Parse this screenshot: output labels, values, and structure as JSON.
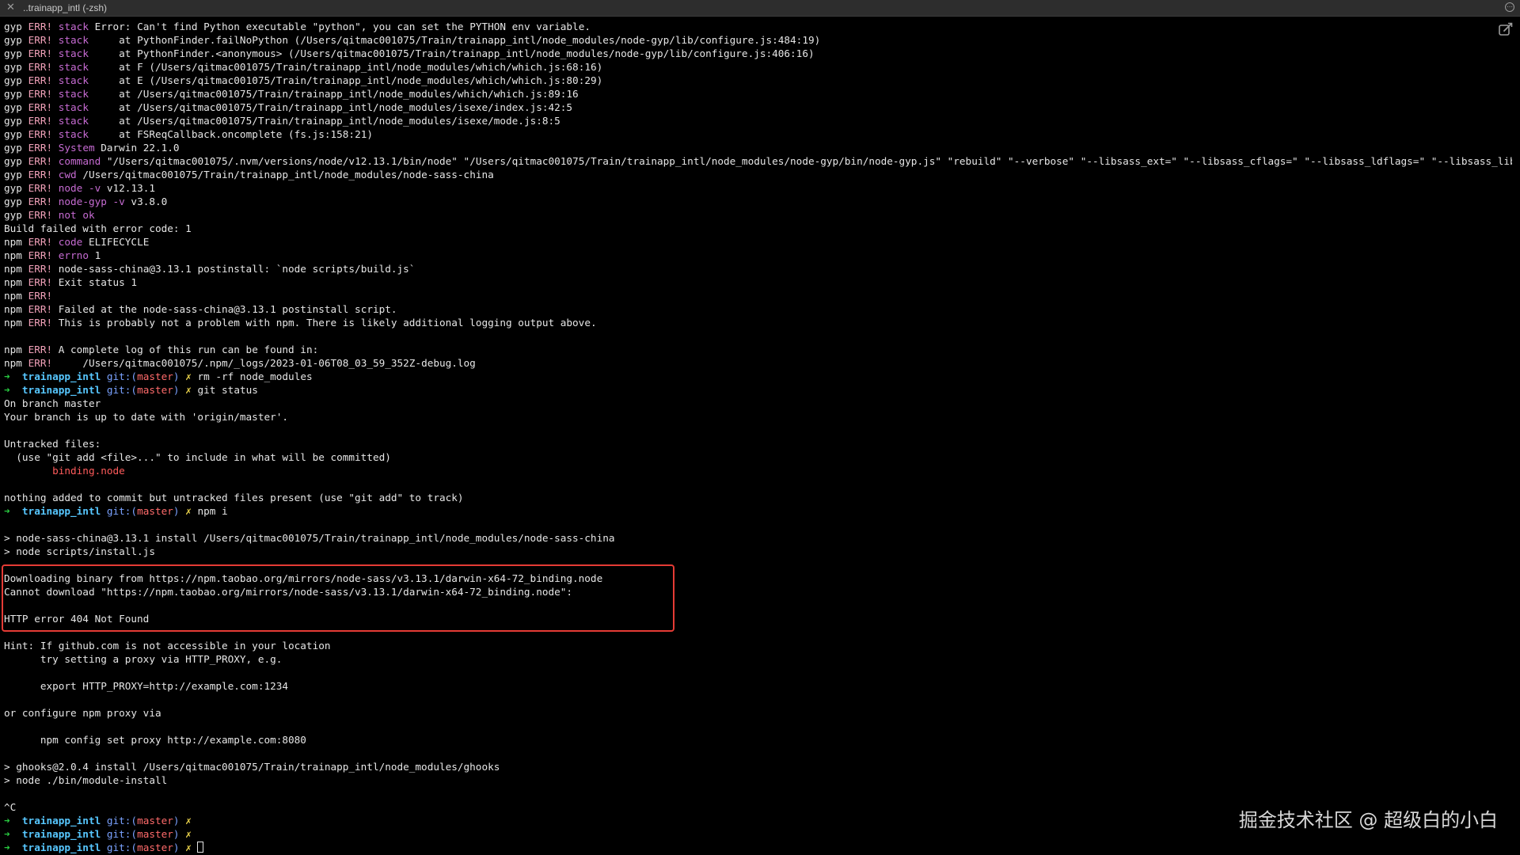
{
  "window": {
    "title": "..trainapp_intl (-zsh)"
  },
  "watermark": {
    "text": "掘金技术社区 @ 超级白的小白"
  },
  "colors": {
    "background": "#000000",
    "text": "#e6e6e6",
    "err": "#f0a0b8",
    "keyword": "#c66bd2",
    "prompt_arrow": "#28c940",
    "prompt_dir": "#57c7ff",
    "branch": "#ff6b6b",
    "highlight_box": "#e53b35"
  },
  "icons": {
    "close": "close-icon",
    "title_right": "window-options-icon",
    "edit": "edit-window-icon"
  },
  "terminal": {
    "lines": [
      [
        {
          "t": "gyp ",
          "c": "text"
        },
        {
          "t": "ERR!",
          "c": "err"
        },
        {
          "t": " ",
          "c": "text"
        },
        {
          "t": "stack",
          "c": "key"
        },
        {
          "t": " Error: Can't find Python executable \"python\", you can set the PYTHON env variable.",
          "c": "text"
        }
      ],
      [
        {
          "t": "gyp ",
          "c": "text"
        },
        {
          "t": "ERR!",
          "c": "err"
        },
        {
          "t": " ",
          "c": "text"
        },
        {
          "t": "stack",
          "c": "key"
        },
        {
          "t": "     at PythonFinder.failNoPython (/Users/qitmac001075/Train/trainapp_intl/node_modules/node-gyp/lib/configure.js:484:19)",
          "c": "text"
        }
      ],
      [
        {
          "t": "gyp ",
          "c": "text"
        },
        {
          "t": "ERR!",
          "c": "err"
        },
        {
          "t": " ",
          "c": "text"
        },
        {
          "t": "stack",
          "c": "key"
        },
        {
          "t": "     at PythonFinder.<anonymous> (/Users/qitmac001075/Train/trainapp_intl/node_modules/node-gyp/lib/configure.js:406:16)",
          "c": "text"
        }
      ],
      [
        {
          "t": "gyp ",
          "c": "text"
        },
        {
          "t": "ERR!",
          "c": "err"
        },
        {
          "t": " ",
          "c": "text"
        },
        {
          "t": "stack",
          "c": "key"
        },
        {
          "t": "     at F (/Users/qitmac001075/Train/trainapp_intl/node_modules/which/which.js:68:16)",
          "c": "text"
        }
      ],
      [
        {
          "t": "gyp ",
          "c": "text"
        },
        {
          "t": "ERR!",
          "c": "err"
        },
        {
          "t": " ",
          "c": "text"
        },
        {
          "t": "stack",
          "c": "key"
        },
        {
          "t": "     at E (/Users/qitmac001075/Train/trainapp_intl/node_modules/which/which.js:80:29)",
          "c": "text"
        }
      ],
      [
        {
          "t": "gyp ",
          "c": "text"
        },
        {
          "t": "ERR!",
          "c": "err"
        },
        {
          "t": " ",
          "c": "text"
        },
        {
          "t": "stack",
          "c": "key"
        },
        {
          "t": "     at /Users/qitmac001075/Train/trainapp_intl/node_modules/which/which.js:89:16",
          "c": "text"
        }
      ],
      [
        {
          "t": "gyp ",
          "c": "text"
        },
        {
          "t": "ERR!",
          "c": "err"
        },
        {
          "t": " ",
          "c": "text"
        },
        {
          "t": "stack",
          "c": "key"
        },
        {
          "t": "     at /Users/qitmac001075/Train/trainapp_intl/node_modules/isexe/index.js:42:5",
          "c": "text"
        }
      ],
      [
        {
          "t": "gyp ",
          "c": "text"
        },
        {
          "t": "ERR!",
          "c": "err"
        },
        {
          "t": " ",
          "c": "text"
        },
        {
          "t": "stack",
          "c": "key"
        },
        {
          "t": "     at /Users/qitmac001075/Train/trainapp_intl/node_modules/isexe/mode.js:8:5",
          "c": "text"
        }
      ],
      [
        {
          "t": "gyp ",
          "c": "text"
        },
        {
          "t": "ERR!",
          "c": "err"
        },
        {
          "t": " ",
          "c": "text"
        },
        {
          "t": "stack",
          "c": "key"
        },
        {
          "t": "     at FSReqCallback.oncomplete (fs.js:158:21)",
          "c": "text"
        }
      ],
      [
        {
          "t": "gyp ",
          "c": "text"
        },
        {
          "t": "ERR!",
          "c": "err"
        },
        {
          "t": " ",
          "c": "text"
        },
        {
          "t": "System",
          "c": "key"
        },
        {
          "t": " Darwin 22.1.0",
          "c": "text"
        }
      ],
      [
        {
          "t": "gyp ",
          "c": "text"
        },
        {
          "t": "ERR!",
          "c": "err"
        },
        {
          "t": " ",
          "c": "text"
        },
        {
          "t": "command",
          "c": "key"
        },
        {
          "t": " \"/Users/qitmac001075/.nvm/versions/node/v12.13.1/bin/node\" \"/Users/qitmac001075/Train/trainapp_intl/node_modules/node-gyp/bin/node-gyp.js\" \"rebuild\" \"--verbose\" \"--libsass_ext=\" \"--libsass_cflags=\" \"--libsass_ldflags=\" \"--libsass_library=\"",
          "c": "text"
        }
      ],
      [
        {
          "t": "gyp ",
          "c": "text"
        },
        {
          "t": "ERR!",
          "c": "err"
        },
        {
          "t": " ",
          "c": "text"
        },
        {
          "t": "cwd",
          "c": "key"
        },
        {
          "t": " /Users/qitmac001075/Train/trainapp_intl/node_modules/node-sass-china",
          "c": "text"
        }
      ],
      [
        {
          "t": "gyp ",
          "c": "text"
        },
        {
          "t": "ERR!",
          "c": "err"
        },
        {
          "t": " ",
          "c": "text"
        },
        {
          "t": "node -v",
          "c": "key"
        },
        {
          "t": " v12.13.1",
          "c": "text"
        }
      ],
      [
        {
          "t": "gyp ",
          "c": "text"
        },
        {
          "t": "ERR!",
          "c": "err"
        },
        {
          "t": " ",
          "c": "text"
        },
        {
          "t": "node-gyp -v",
          "c": "key"
        },
        {
          "t": " v3.8.0",
          "c": "text"
        }
      ],
      [
        {
          "t": "gyp ",
          "c": "text"
        },
        {
          "t": "ERR!",
          "c": "err"
        },
        {
          "t": " ",
          "c": "text"
        },
        {
          "t": "not ok",
          "c": "key"
        }
      ],
      [
        {
          "t": "Build failed with error code: 1",
          "c": "text"
        }
      ],
      [
        {
          "t": "npm ",
          "c": "text"
        },
        {
          "t": "ERR!",
          "c": "err"
        },
        {
          "t": " ",
          "c": "text"
        },
        {
          "t": "code",
          "c": "key"
        },
        {
          "t": " ELIFECYCLE",
          "c": "text"
        }
      ],
      [
        {
          "t": "npm ",
          "c": "text"
        },
        {
          "t": "ERR!",
          "c": "err"
        },
        {
          "t": " ",
          "c": "text"
        },
        {
          "t": "errno",
          "c": "key"
        },
        {
          "t": " 1",
          "c": "text"
        }
      ],
      [
        {
          "t": "npm ",
          "c": "text"
        },
        {
          "t": "ERR!",
          "c": "err"
        },
        {
          "t": " node-sass-china@3.13.1 postinstall: `node scripts/build.js`",
          "c": "text"
        }
      ],
      [
        {
          "t": "npm ",
          "c": "text"
        },
        {
          "t": "ERR!",
          "c": "err"
        },
        {
          "t": " Exit status 1",
          "c": "text"
        }
      ],
      [
        {
          "t": "npm ",
          "c": "text"
        },
        {
          "t": "ERR!",
          "c": "err"
        }
      ],
      [
        {
          "t": "npm ",
          "c": "text"
        },
        {
          "t": "ERR!",
          "c": "err"
        },
        {
          "t": " Failed at the node-sass-china@3.13.1 postinstall script.",
          "c": "text"
        }
      ],
      [
        {
          "t": "npm ",
          "c": "text"
        },
        {
          "t": "ERR!",
          "c": "err"
        },
        {
          "t": " This is probably not a problem with npm. There is likely additional logging output above.",
          "c": "text"
        }
      ],
      [],
      [
        {
          "t": "npm ",
          "c": "text"
        },
        {
          "t": "ERR!",
          "c": "err"
        },
        {
          "t": " A complete log of this run can be found in:",
          "c": "text"
        }
      ],
      [
        {
          "t": "npm ",
          "c": "text"
        },
        {
          "t": "ERR!",
          "c": "err"
        },
        {
          "t": "     /Users/qitmac001075/.npm/_logs/2023-01-06T08_03_59_352Z-debug.log",
          "c": "text"
        }
      ],
      [
        {
          "t": "➜",
          "c": "arrow"
        },
        {
          "t": "  ",
          "c": "text"
        },
        {
          "t": "trainapp_intl",
          "c": "dir"
        },
        {
          "t": " ",
          "c": "text"
        },
        {
          "t": "git:(",
          "c": "git"
        },
        {
          "t": "master",
          "c": "branch"
        },
        {
          "t": ")",
          "c": "git"
        },
        {
          "t": " ✗",
          "c": "x"
        },
        {
          "t": " rm -rf node_modules",
          "c": "text"
        }
      ],
      [
        {
          "t": "➜",
          "c": "arrow"
        },
        {
          "t": "  ",
          "c": "text"
        },
        {
          "t": "trainapp_intl",
          "c": "dir"
        },
        {
          "t": " ",
          "c": "text"
        },
        {
          "t": "git:(",
          "c": "git"
        },
        {
          "t": "master",
          "c": "branch"
        },
        {
          "t": ")",
          "c": "git"
        },
        {
          "t": " ✗",
          "c": "x"
        },
        {
          "t": " git status",
          "c": "text"
        }
      ],
      [
        {
          "t": "On branch master",
          "c": "text"
        }
      ],
      [
        {
          "t": "Your branch is up to date with 'origin/master'.",
          "c": "text"
        }
      ],
      [],
      [
        {
          "t": "Untracked files:",
          "c": "text"
        }
      ],
      [
        {
          "t": "  (use \"git add <file>...\" to include in what will be committed)",
          "c": "text"
        }
      ],
      [
        {
          "t": "        binding.node",
          "c": "red"
        }
      ],
      [],
      [
        {
          "t": "nothing added to commit but untracked files present (use \"git add\" to track)",
          "c": "text"
        }
      ],
      [
        {
          "t": "➜",
          "c": "arrow"
        },
        {
          "t": "  ",
          "c": "text"
        },
        {
          "t": "trainapp_intl",
          "c": "dir"
        },
        {
          "t": " ",
          "c": "text"
        },
        {
          "t": "git:(",
          "c": "git"
        },
        {
          "t": "master",
          "c": "branch"
        },
        {
          "t": ")",
          "c": "git"
        },
        {
          "t": " ✗",
          "c": "x"
        },
        {
          "t": " npm i",
          "c": "text"
        }
      ],
      [],
      [
        {
          "t": "> node-sass-china@3.13.1 install /Users/qitmac001075/Train/trainapp_intl/node_modules/node-sass-china",
          "c": "text"
        }
      ],
      [
        {
          "t": "> node scripts/install.js",
          "c": "text"
        }
      ],
      [],
      [
        {
          "t": "Downloading binary from https://npm.taobao.org/mirrors/node-sass/v3.13.1/darwin-x64-72_binding.node",
          "c": "text"
        }
      ],
      [
        {
          "t": "Cannot download \"https://npm.taobao.org/mirrors/node-sass/v3.13.1/darwin-x64-72_binding.node\":",
          "c": "text"
        }
      ],
      [],
      [
        {
          "t": "HTTP error 404 Not Found",
          "c": "text"
        }
      ],
      [],
      [
        {
          "t": "Hint: If github.com is not accessible in your location",
          "c": "text"
        }
      ],
      [
        {
          "t": "      try setting a proxy via HTTP_PROXY, e.g.",
          "c": "text"
        }
      ],
      [],
      [
        {
          "t": "      export HTTP_PROXY=http://example.com:1234",
          "c": "text"
        }
      ],
      [],
      [
        {
          "t": "or configure npm proxy via",
          "c": "text"
        }
      ],
      [],
      [
        {
          "t": "      npm config set proxy http://example.com:8080",
          "c": "text"
        }
      ],
      [],
      [
        {
          "t": "> ghooks@2.0.4 install /Users/qitmac001075/Train/trainapp_intl/node_modules/ghooks",
          "c": "text"
        }
      ],
      [
        {
          "t": "> node ./bin/module-install",
          "c": "text"
        }
      ],
      [],
      [
        {
          "t": "^C",
          "c": "text"
        }
      ],
      [
        {
          "t": "➜",
          "c": "arrow"
        },
        {
          "t": "  ",
          "c": "text"
        },
        {
          "t": "trainapp_intl",
          "c": "dir"
        },
        {
          "t": " ",
          "c": "text"
        },
        {
          "t": "git:(",
          "c": "git"
        },
        {
          "t": "master",
          "c": "branch"
        },
        {
          "t": ")",
          "c": "git"
        },
        {
          "t": " ✗",
          "c": "x"
        }
      ],
      [
        {
          "t": "➜",
          "c": "arrow"
        },
        {
          "t": "  ",
          "c": "text"
        },
        {
          "t": "trainapp_intl",
          "c": "dir"
        },
        {
          "t": " ",
          "c": "text"
        },
        {
          "t": "git:(",
          "c": "git"
        },
        {
          "t": "master",
          "c": "branch"
        },
        {
          "t": ")",
          "c": "git"
        },
        {
          "t": " ✗",
          "c": "x"
        }
      ],
      [
        {
          "t": "➜",
          "c": "arrow"
        },
        {
          "t": "  ",
          "c": "text"
        },
        {
          "t": "trainapp_intl",
          "c": "dir"
        },
        {
          "t": " ",
          "c": "text"
        },
        {
          "t": "git:(",
          "c": "git"
        },
        {
          "t": "master",
          "c": "branch"
        },
        {
          "t": ")",
          "c": "git"
        },
        {
          "t": " ✗",
          "c": "x"
        },
        {
          "t": " ",
          "c": "text"
        },
        {
          "t": "",
          "c": "cursor"
        }
      ]
    ]
  }
}
